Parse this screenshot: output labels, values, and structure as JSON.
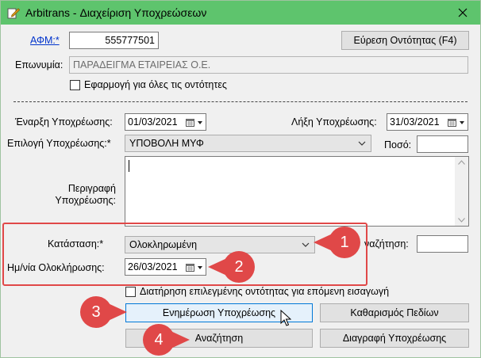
{
  "window": {
    "title": "Arbitrans - Διαχείριση Υποχρεώσεων"
  },
  "afm": {
    "label": "ΑΦΜ:*",
    "value": "555777501"
  },
  "find_entity_button": "Εύρεση Οντότητας (F4)",
  "name": {
    "label": "Επωνυμία:",
    "value": "ΠΑΡΑΔΕΙΓΜΑ ΕΤΑΙΡΕΙΑΣ Ο.Ε."
  },
  "apply_all_checkbox": "Εφαρμογή για όλες τις οντότητες",
  "start_date": {
    "label": "Έναρξη Υποχρέωσης:",
    "value": "01/03/2021"
  },
  "end_date": {
    "label": "Λήξη Υποχρέωσης:",
    "value": "31/03/2021"
  },
  "obligation_select": {
    "label": "Επιλογή Υποχρέωσης:*",
    "value": "ΥΠΟΒΟΛΗ ΜΥΦ"
  },
  "amount": {
    "label": "Ποσό:",
    "value": ""
  },
  "description": {
    "label_line1": "Περιγραφή",
    "label_line2": "Υποχρέωσης:",
    "value": ""
  },
  "status": {
    "label": "Κατάσταση:*",
    "value": "Ολοκληρωμένη"
  },
  "search_field": {
    "label": "ναζήτηση:",
    "value": ""
  },
  "completion_date": {
    "label": "Ημ/νία Ολοκλήρωσης:",
    "value": "26/03/2021"
  },
  "keep_entity_checkbox": "Διατήρηση επιλεγμένης οντότητας για επόμενη εισαγωγή",
  "buttons": {
    "update": "Ενημέρωση Υποχρέωσης",
    "clear": "Καθαρισμός Πεδίων",
    "search": "Αναζήτηση",
    "delete": "Διαγραφή Υποχρέωσης"
  },
  "callouts": [
    "1",
    "2",
    "3",
    "4"
  ],
  "colors": {
    "titlebar": "#5ec46d",
    "callout": "#e04848",
    "highlight": "#e04848",
    "focus": "#0078d7"
  }
}
